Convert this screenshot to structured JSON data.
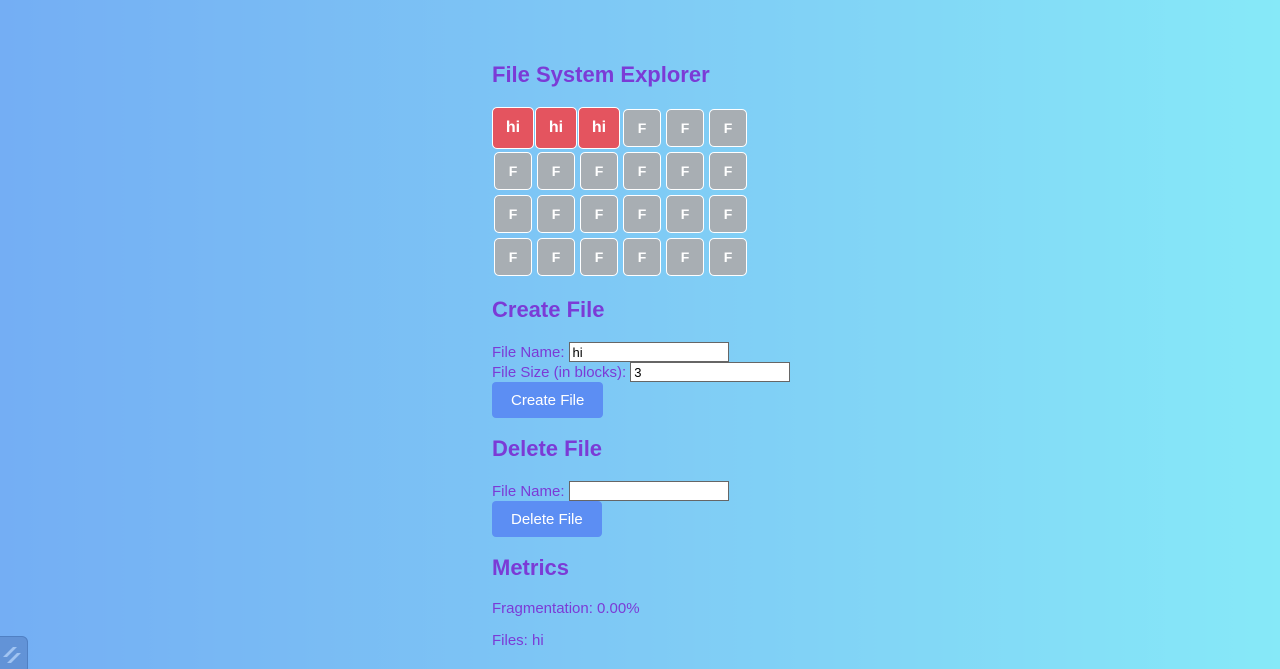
{
  "page": {
    "title": "File System Explorer"
  },
  "blocks": [
    "hi",
    "hi",
    "hi",
    "F",
    "F",
    "F",
    "F",
    "F",
    "F",
    "F",
    "F",
    "F",
    "F",
    "F",
    "F",
    "F",
    "F",
    "F",
    "F",
    "F",
    "F",
    "F",
    "F",
    "F"
  ],
  "used_blocks": 3,
  "colors": {
    "used_block": "#e4545f",
    "free_block": "#a8aeb3",
    "accent_text": "#7b3bd6",
    "button": "#5c8ef3"
  },
  "create": {
    "heading": "Create File",
    "name_label": "File Name:",
    "name_value": "hi",
    "size_label": "File Size (in blocks):",
    "size_value": "3",
    "button_label": "Create File"
  },
  "delete": {
    "heading": "Delete File",
    "name_label": "File Name:",
    "name_value": "",
    "button_label": "Delete File"
  },
  "metrics": {
    "heading": "Metrics",
    "fragmentation": "Fragmentation: 0.00%",
    "files": "Files: hi"
  },
  "corner_widget": {
    "icon": "app-logo-icon"
  }
}
